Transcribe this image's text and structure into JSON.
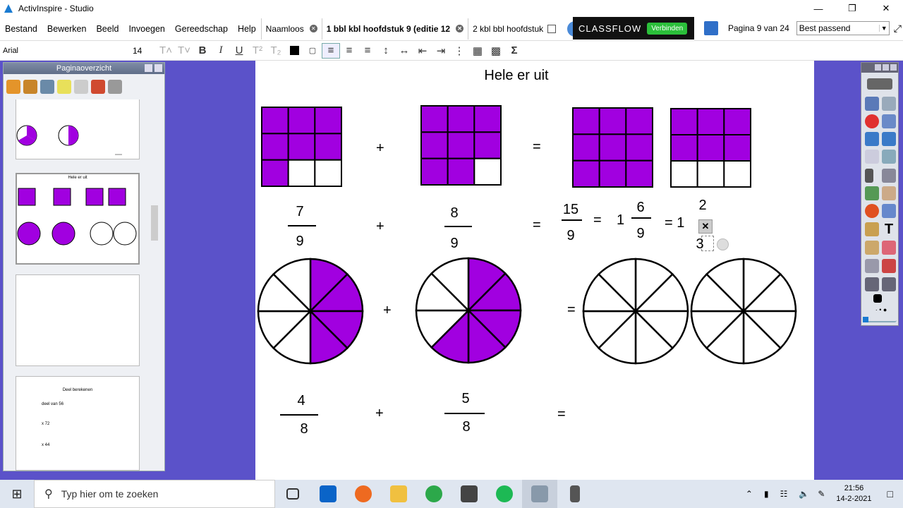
{
  "window": {
    "title": "ActivInspire - Studio"
  },
  "menu": [
    "Bestand",
    "Bewerken",
    "Beeld",
    "Invoegen",
    "Gereedschap",
    "Help"
  ],
  "tabs": [
    {
      "label": "Naamloos"
    },
    {
      "label": "1 bbl kbl hoofdstuk 9 (editie 12"
    },
    {
      "label": "2 kbl bbl hoofdstuk"
    }
  ],
  "classflow": {
    "logo": "CLASSFLOW",
    "connect": "Verbinden"
  },
  "pager": {
    "label": "Pagina 9 van 24",
    "zoom": "Best passend"
  },
  "font": {
    "name": "Arial",
    "size": "14"
  },
  "panel": {
    "title": "Paginaoverzicht",
    "thumb2_title": "Hele er uit",
    "thumb4_title": "Deel berekenen",
    "thumb4_lines": [
      "deel van 56",
      "x 72",
      "x 44"
    ]
  },
  "page": {
    "title": "Hele er uit",
    "row1": {
      "plus": "+",
      "eq": "="
    },
    "row2": {
      "f1n": "7",
      "f1d": "9",
      "plus": "+",
      "f2n": "8",
      "f2d": "9",
      "eq": "=",
      "r1n": "15",
      "r1d": "9",
      "eq2": "=",
      "whole1": "1",
      "r2n": "6",
      "r2d": "9",
      "eq3": "= 1",
      "r3n": "2",
      "r3d": "3"
    },
    "row3": {
      "plus": "+",
      "eq": "="
    },
    "row4": {
      "f1n": "4",
      "f1d": "8",
      "plus": "+",
      "f2n": "5",
      "f2d": "8",
      "eq": "="
    }
  },
  "chart_data": {
    "fill_color": "#a100e0"
  },
  "taskbar": {
    "search": "Typ hier om te zoeken",
    "time": "21:56",
    "date": "14-2-2021"
  }
}
